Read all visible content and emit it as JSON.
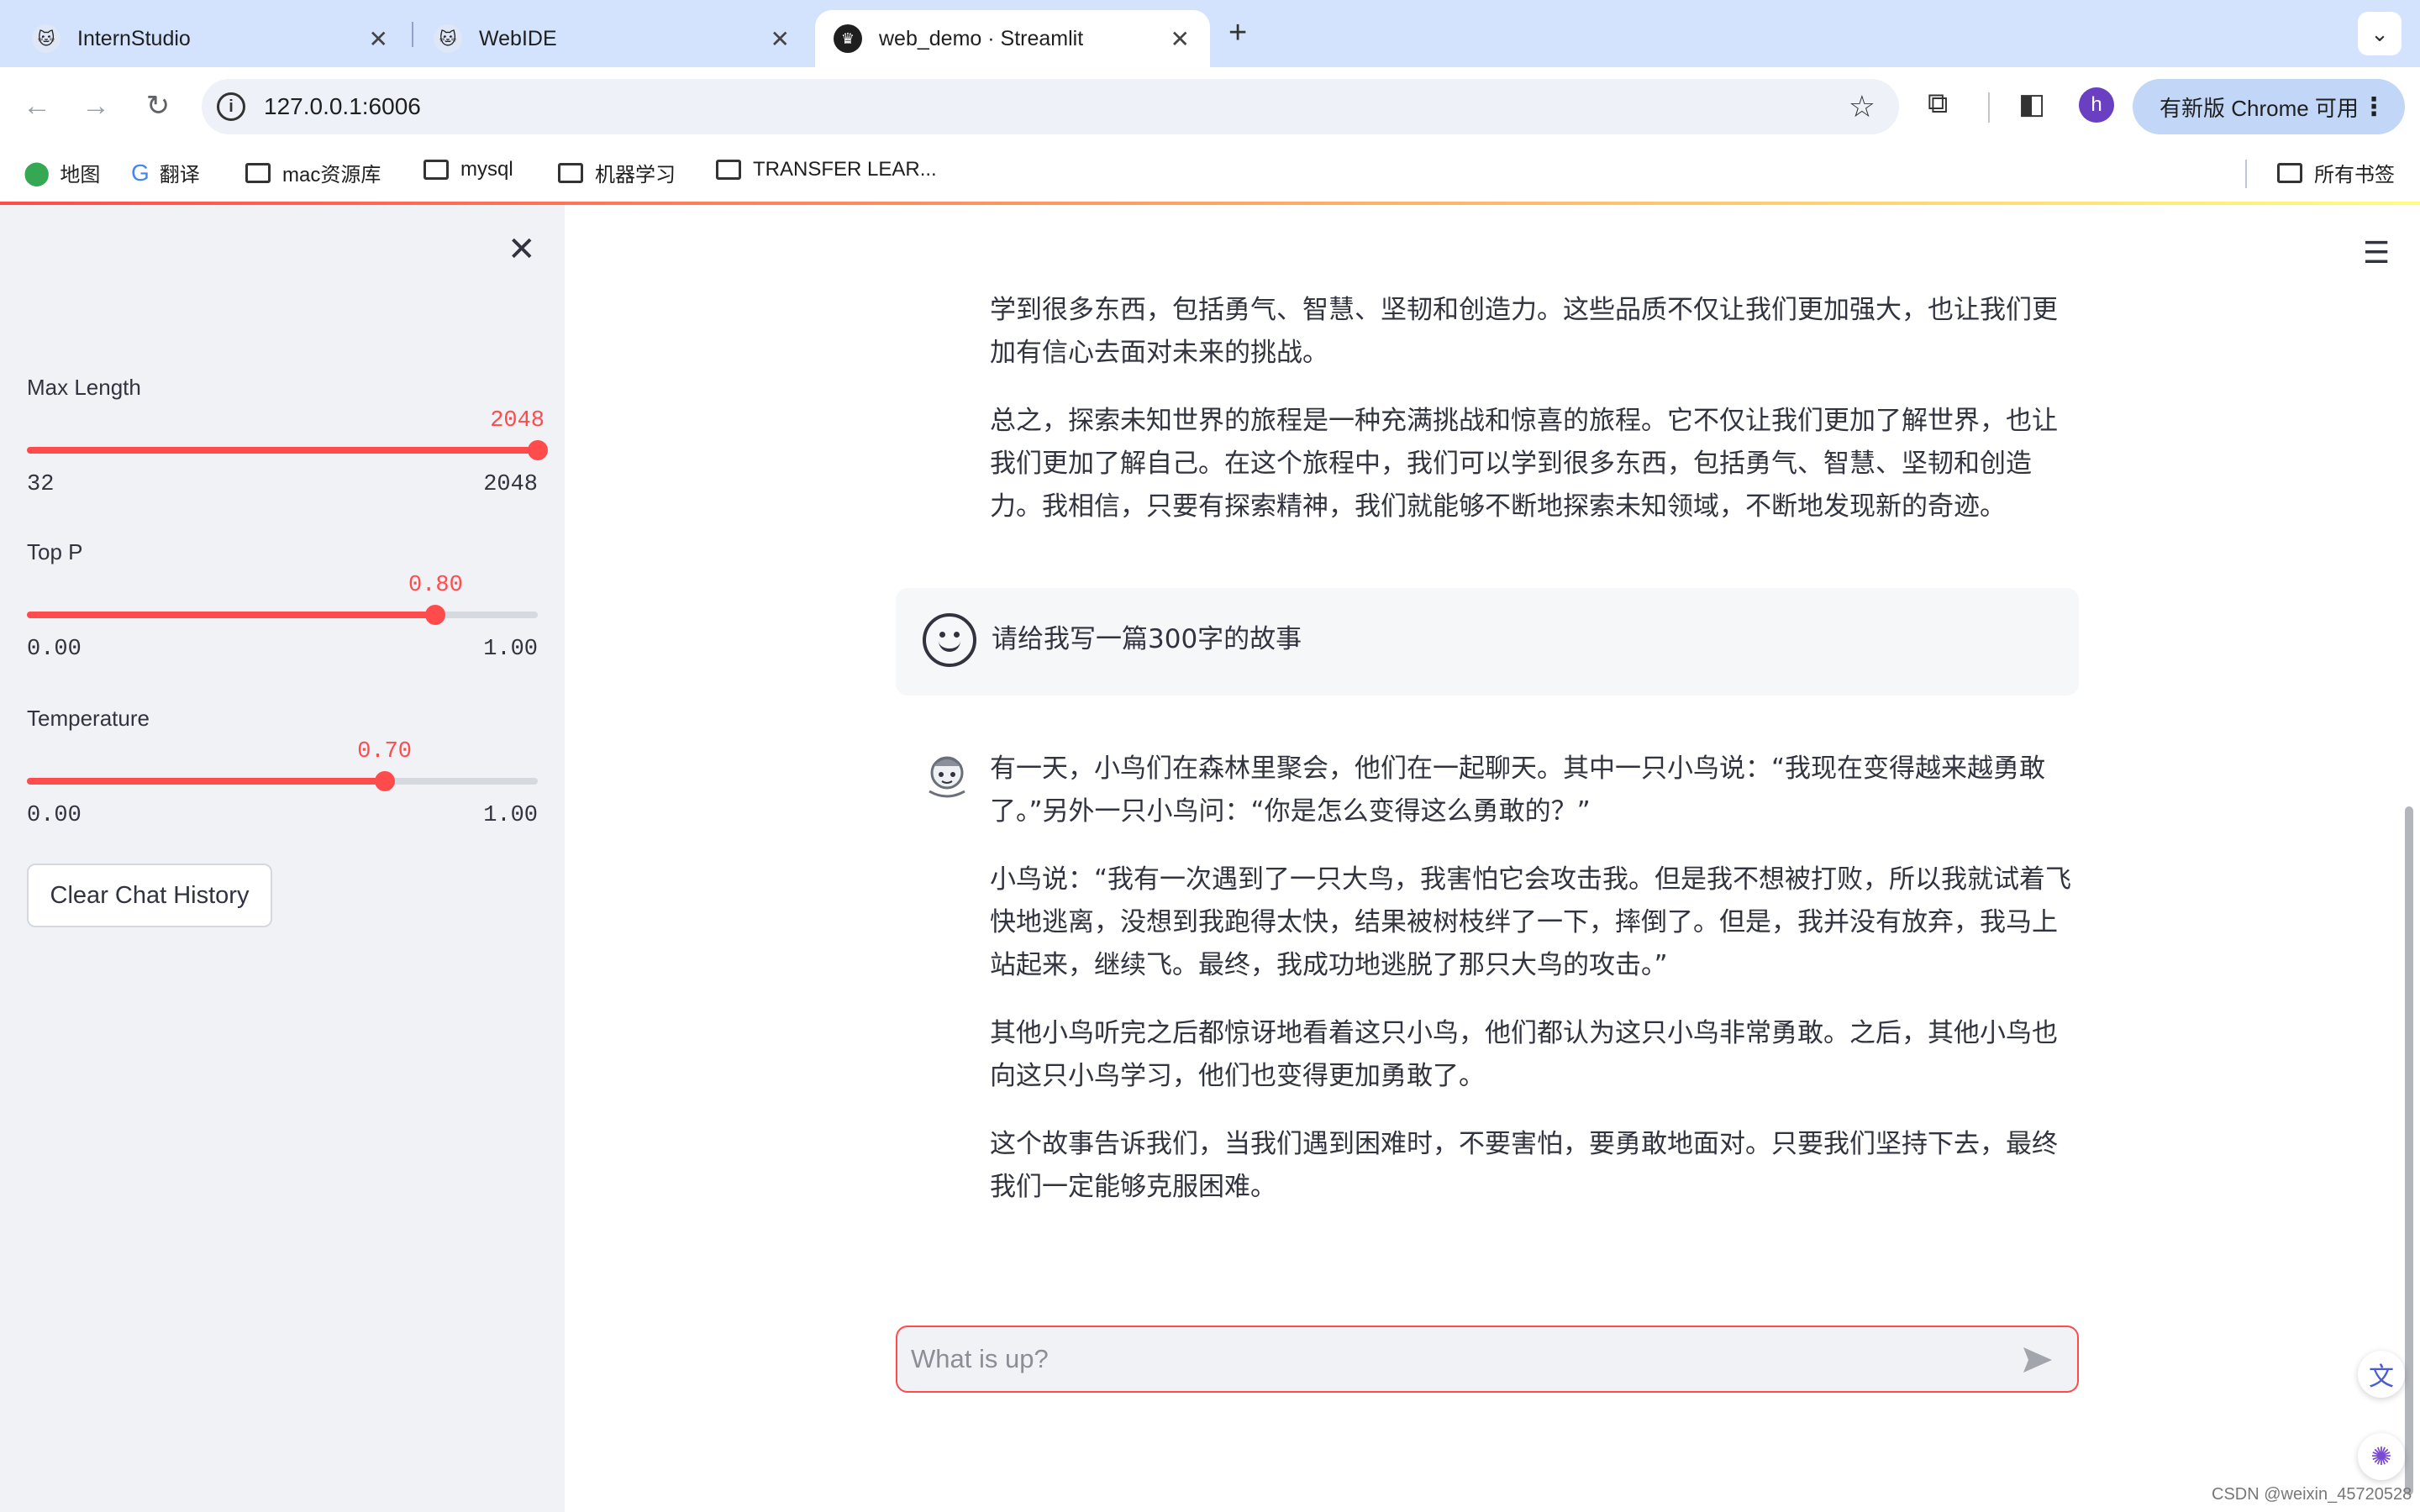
{
  "browser": {
    "tabs": [
      {
        "title": "InternStudio"
      },
      {
        "title": "WebIDE"
      },
      {
        "title": "web_demo · Streamlit"
      }
    ],
    "url": "127.0.0.1:6006",
    "update_label": "有新版 Chrome 可用",
    "avatar_letter": "h",
    "bookmarks": [
      "地图",
      "翻译",
      "mac资源库",
      "mysql",
      "机器学习",
      "TRANSFER LEAR..."
    ],
    "all_bookmarks": "所有书签"
  },
  "sidebar": {
    "sliders": [
      {
        "label": "Max Length",
        "value": "2048",
        "min": "32",
        "max": "2048",
        "fraction": 1.0
      },
      {
        "label": "Top P",
        "value": "0.80",
        "min": "0.00",
        "max": "1.00",
        "fraction": 0.8
      },
      {
        "label": "Temperature",
        "value": "0.70",
        "min": "0.00",
        "max": "1.00",
        "fraction": 0.7
      }
    ],
    "clear_button": "Clear Chat History"
  },
  "chat": {
    "prev_paragraphs": [
      "学到很多东西，包括勇气、智慧、坚韧和创造力。这些品质不仅让我们更加强大，也让我们更加有信心去面对未来的挑战。",
      "总之，探索未知世界的旅程是一种充满挑战和惊喜的旅程。它不仅让我们更加了解世界，也让我们更加了解自己。在这个旅程中，我们可以学到很多东西，包括勇气、智慧、坚韧和创造力。我相信，只要有探索精神，我们就能够不断地探索未知领域，不断地发现新的奇迹。"
    ],
    "user_message": "请给我写一篇300字的故事",
    "assistant_paragraphs": [
      "有一天，小鸟们在森林里聚会，他们在一起聊天。其中一只小鸟说：“我现在变得越来越勇敢了。”另外一只小鸟问：“你是怎么变得这么勇敢的？”",
      "小鸟说：“我有一次遇到了一只大鸟，我害怕它会攻击我。但是我不想被打败，所以我就试着飞快地逃离，没想到我跑得太快，结果被树枝绊了一下，摔倒了。但是，我并没有放弃，我马上站起来，继续飞。最终，我成功地逃脱了那只大鸟的攻击。”",
      "其他小鸟听完之后都惊讶地看着这只小鸟，他们都认为这只小鸟非常勇敢。之后，其他小鸟也向这只小鸟学习，他们也变得更加勇敢了。",
      "这个故事告诉我们，当我们遇到困难时，不要害怕，要勇敢地面对。只要我们坚持下去，最终我们一定能够克服困难。"
    ],
    "input_placeholder": "What is up?"
  },
  "watermark": "CSDN @weixin_45720528",
  "colors": {
    "accent": "#ff4b4b",
    "sidebar_bg": "#f0f2f6",
    "tabbar_bg": "#d3e3fd"
  }
}
